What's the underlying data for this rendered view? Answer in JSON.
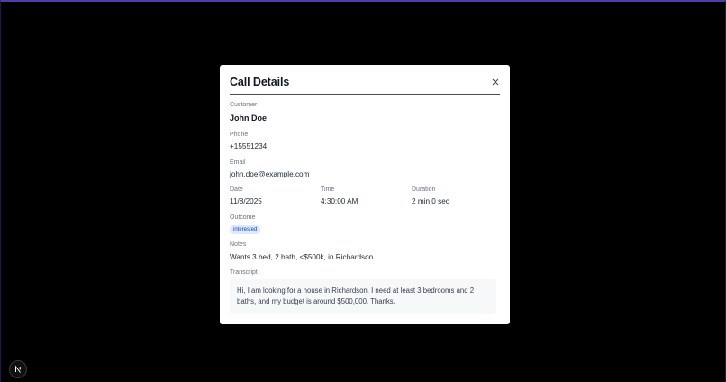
{
  "modal": {
    "title": "Call Details",
    "close_icon": "close-icon"
  },
  "customer": {
    "label": "Customer",
    "value": "John Doe"
  },
  "phone": {
    "label": "Phone",
    "value": "+15551234"
  },
  "email": {
    "label": "Email",
    "value": "john.doe@example.com"
  },
  "date": {
    "label": "Date",
    "value": "11/8/2025"
  },
  "time": {
    "label": "Time",
    "value": "4:30:00 AM"
  },
  "duration": {
    "label": "Duration",
    "value": "2 min 0 sec"
  },
  "outcome": {
    "label": "Outcome",
    "value": "interested"
  },
  "notes": {
    "label": "Notes",
    "value": "Wants 3 bed, 2 bath, <$500k, in Richardson."
  },
  "transcript": {
    "label": "Transcript",
    "value": "Hi, I am looking for a house in Richardson. I need at least 3 bedrooms and 2 baths, and my budget is around $500,000. Thanks."
  },
  "dev_indicator": {
    "icon": "nextjs-logo-icon",
    "letter": "N"
  },
  "colors": {
    "backdrop": "#000000",
    "modal_bg": "#ffffff",
    "badge_bg": "#dbeafe",
    "badge_text": "#1e40af",
    "transcript_bg": "#f7f8fa"
  }
}
